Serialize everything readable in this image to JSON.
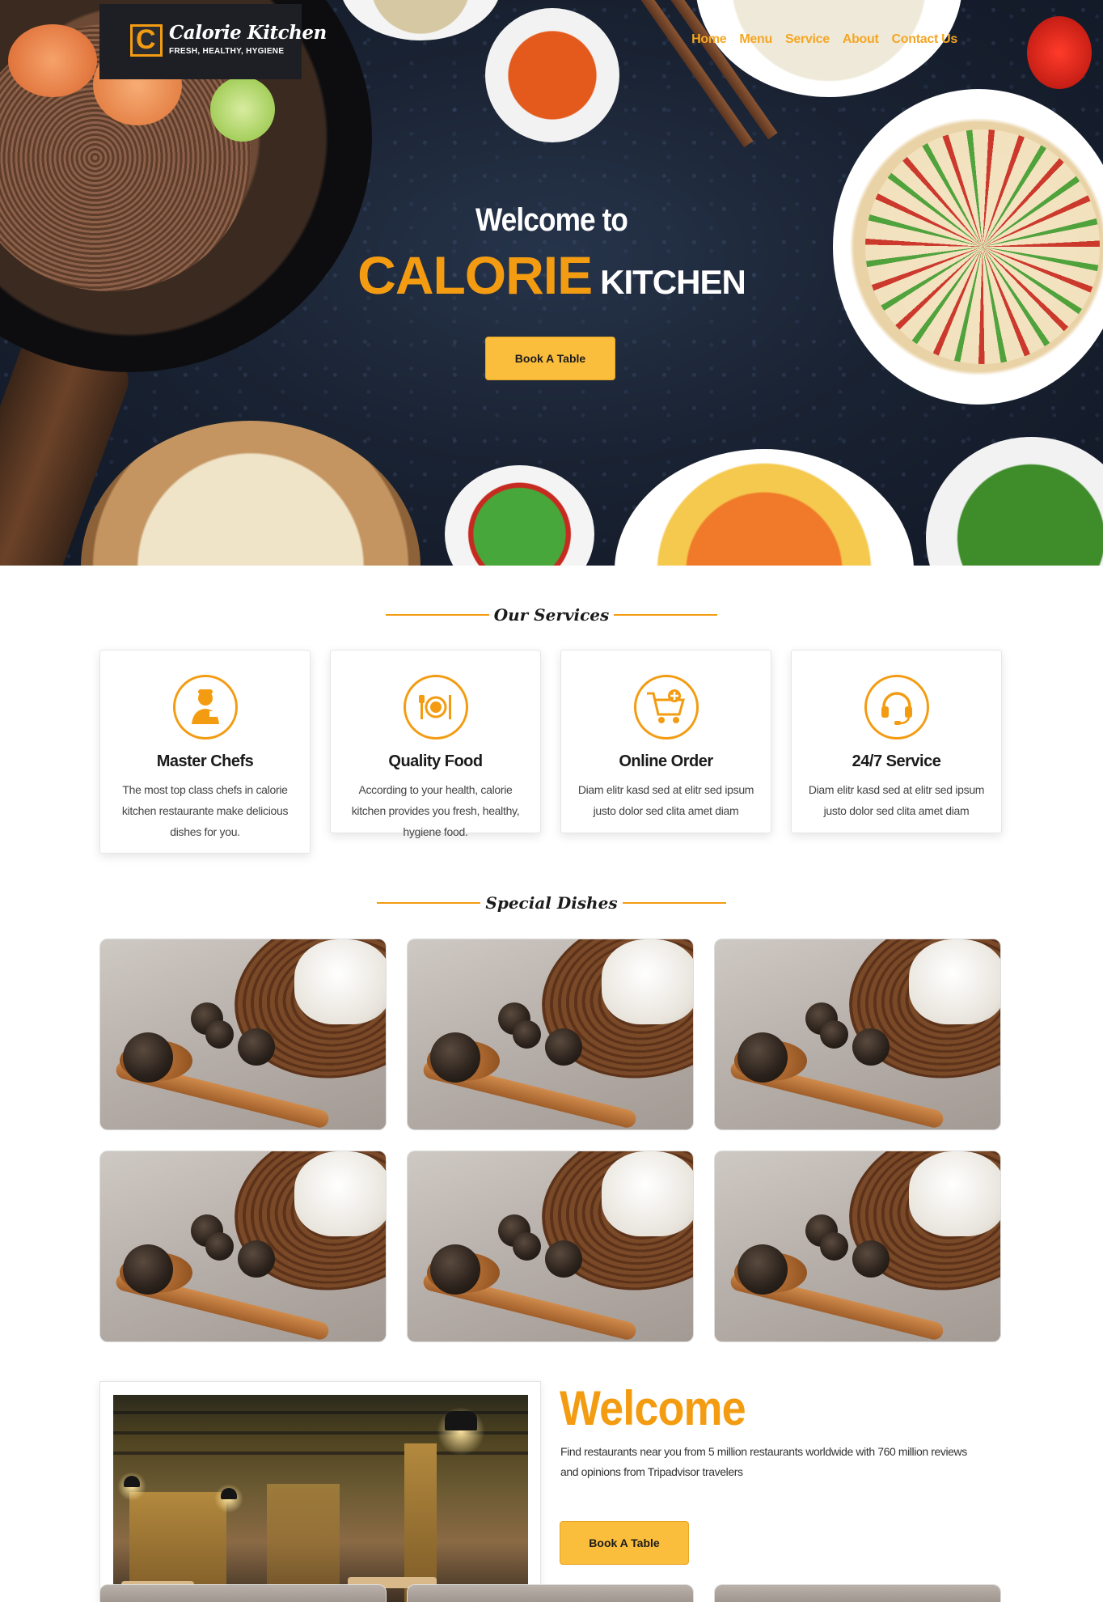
{
  "brand": {
    "name": "Calorie Kitchen",
    "tagline": "FRESH, HEALTHY, HYGIENE",
    "mark": "C",
    "accent_color": "#f39c12",
    "button_color": "#fbbd3c"
  },
  "nav": {
    "items": [
      {
        "label": "Home"
      },
      {
        "label": "Menu"
      },
      {
        "label": "Service"
      },
      {
        "label": "About"
      },
      {
        "label": "Contact Us"
      }
    ]
  },
  "hero": {
    "welcome": "Welcome to",
    "title_accent": "CALORIE",
    "title_rest": "KITCHEN",
    "button_label": "Book A Table"
  },
  "services": {
    "heading": "Our Services",
    "cards": [
      {
        "title": "Master Chefs",
        "text": "The most top class chefs in calorie kitchen restaurante make delicious dishes for you.",
        "icon": "chef-icon"
      },
      {
        "title": "Quality Food",
        "text": "According to your health, calorie kitchen provides you fresh, healthy, hygiene food.",
        "icon": "plate-cutlery-icon"
      },
      {
        "title": "Online Order",
        "text": "Diam elitr kasd sed at elitr sed ipsum justo dolor sed clita amet diam",
        "icon": "cart-icon"
      },
      {
        "title": "24/7 Service",
        "text": "Diam elitr kasd sed at elitr sed ipsum justo dolor sed clita amet diam",
        "icon": "headset-icon"
      }
    ]
  },
  "dishes": {
    "heading": "Special Dishes"
  },
  "welcome": {
    "title": "Welcome",
    "text": "Find restaurants near you from 5 million restaurants worldwide with 760 million reviews and opinions from Tripadvisor travelers",
    "button_label": "Book A Table"
  }
}
